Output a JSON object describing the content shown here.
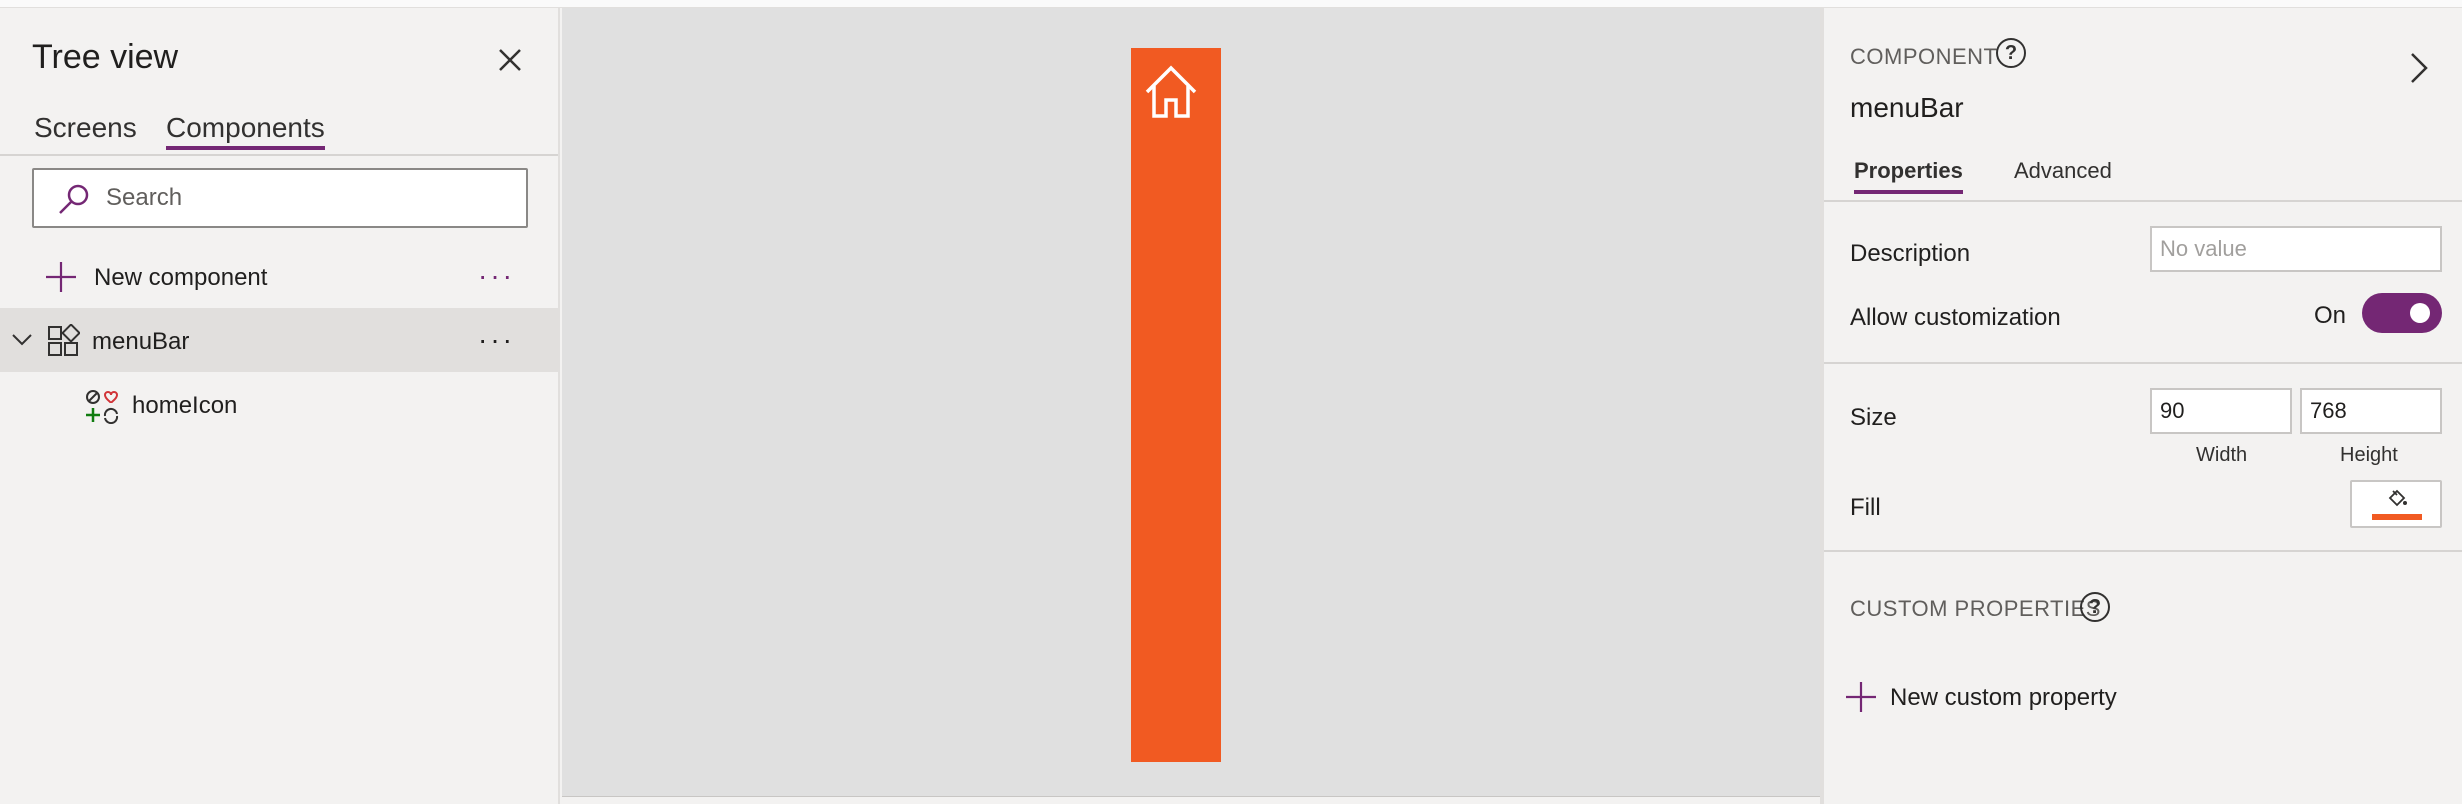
{
  "tree": {
    "title": "Tree view",
    "tabs": [
      {
        "label": "Screens"
      },
      {
        "label": "Components"
      }
    ],
    "search_placeholder": "Search",
    "new_component_label": "New component",
    "more_glyph": "···",
    "items": [
      {
        "label": "menuBar"
      },
      {
        "label": "homeIcon"
      }
    ]
  },
  "canvas": {
    "component_fill": "#f15a22"
  },
  "props": {
    "header": "COMPONENT",
    "help_glyph": "?",
    "component_name": "menuBar",
    "tabs": [
      {
        "label": "Properties"
      },
      {
        "label": "Advanced"
      }
    ],
    "description_label": "Description",
    "description_placeholder": "No value",
    "allow_customization_label": "Allow customization",
    "allow_customization_state": "On",
    "size_label": "Size",
    "width_value": "90",
    "height_value": "768",
    "width_caption": "Width",
    "height_caption": "Height",
    "fill_label": "Fill",
    "custom_properties_header": "CUSTOM PROPERTIES",
    "new_custom_property_label": "New custom property"
  },
  "colors": {
    "accent": "#742774",
    "menubar_fill": "#f15a22"
  }
}
